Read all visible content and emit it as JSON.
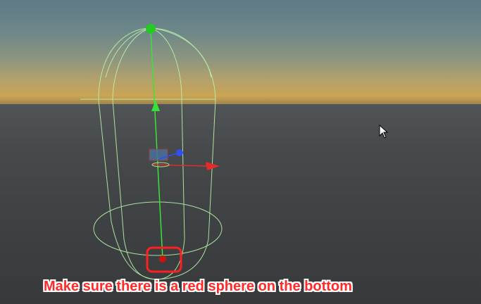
{
  "scene": {
    "background": {
      "sky_top": "#5f7a86",
      "sky_horizon": "#caa452",
      "ground": "#3e4143"
    },
    "capsule_collider": {
      "wire_color": "#b9f2a8"
    },
    "gizmos": {
      "y_axis_color": "#39e239",
      "x_axis_color": "#e62a2a",
      "z_handle_color": "#2f4ff0",
      "top_sphere_color": "#22cc22",
      "bottom_sphere_color": "#cc1111"
    },
    "highlight_box_color": "#ff2020",
    "cursor_icon": "arrow-cursor-icon"
  },
  "annotation": {
    "text": "Make sure there is a red sphere on the bottom"
  }
}
